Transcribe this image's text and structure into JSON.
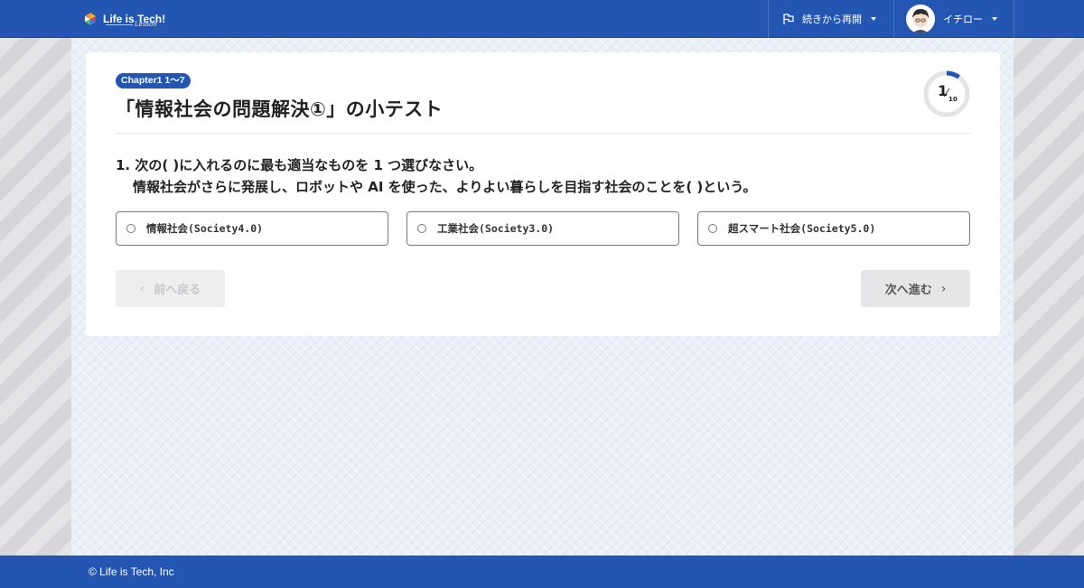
{
  "header": {
    "logo_text": "Life is Tech!",
    "logo_sub": "Lesson",
    "resume_label": "続きから再開",
    "user_name": "イチロー"
  },
  "quiz": {
    "chapter_badge": "Chapter1 1～7",
    "title": "「情報社会の問題解決①」の小テスト",
    "progress": {
      "current": "1",
      "total": "10",
      "fraction": 0.1
    },
    "question_line1": "1. 次の( )に入れるのに最も適当なものを 1 つ選びなさい。",
    "question_line2": "情報社会がさらに発展し、ロボットや AI を使った、よりよい暮らしを目指す社会のことを( )という。",
    "choices": [
      {
        "label": "情報社会(Society4.0)"
      },
      {
        "label": "工業社会(Society3.0)"
      },
      {
        "label": "超スマート社会(Society5.0)"
      }
    ],
    "prev_label": "前へ戻る",
    "next_label": "次へ進む"
  },
  "footer": {
    "copyright": "© Life is Tech, Inc"
  },
  "colors": {
    "brand": "#2356b3",
    "progress_ring": "#2356b3",
    "progress_track": "#e4e4e8"
  }
}
